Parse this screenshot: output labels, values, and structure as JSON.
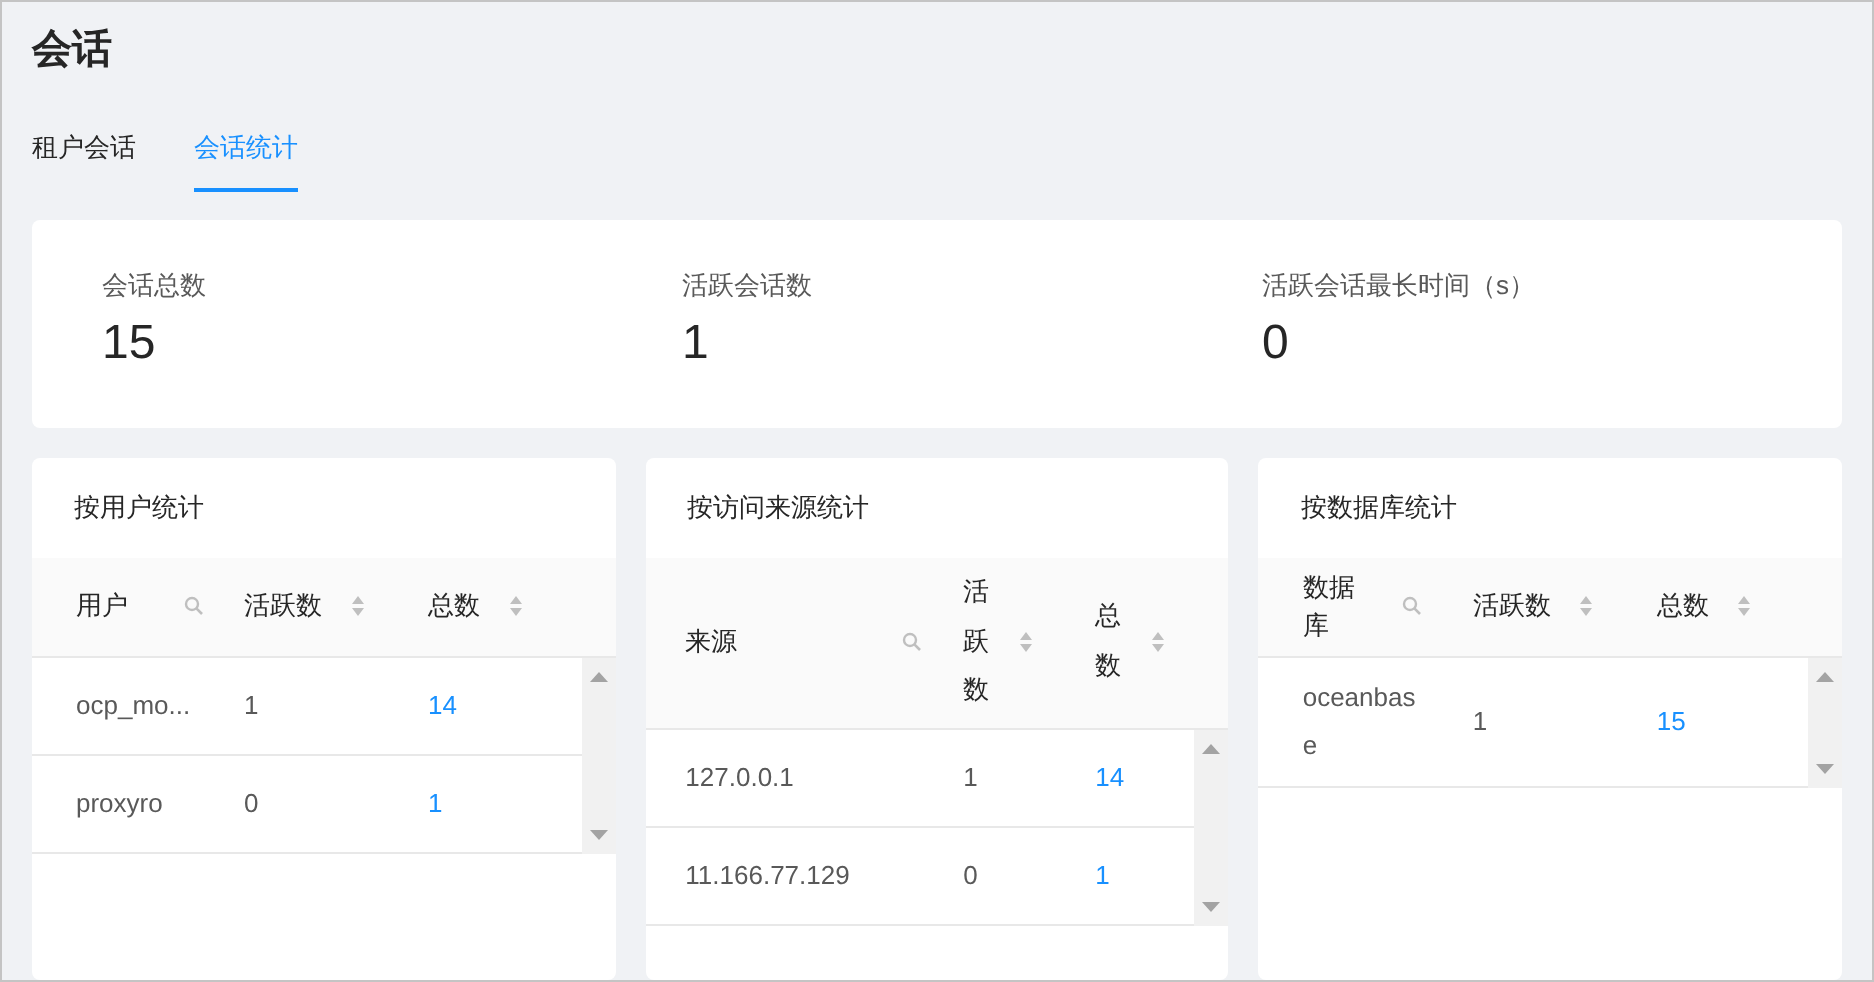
{
  "page_title": "会话",
  "tabs": [
    {
      "label": "租户会话",
      "selected": false
    },
    {
      "label": "会话统计",
      "selected": true
    }
  ],
  "stats": [
    {
      "label": "会话总数",
      "value": "15"
    },
    {
      "label": "活跃会话数",
      "value": "1"
    },
    {
      "label": "活跃会话最长时间（s）",
      "value": "0"
    }
  ],
  "panels": [
    {
      "title": "按用户统计",
      "columns": [
        {
          "label": "用户",
          "kind": "search"
        },
        {
          "label": "活跃数",
          "kind": "sort"
        },
        {
          "label": "总数",
          "kind": "sort"
        }
      ],
      "rows": [
        [
          "ocp_mo...",
          "1",
          "14"
        ],
        [
          "proxyro",
          "0",
          "1"
        ]
      ]
    },
    {
      "title": "按访问来源统计",
      "columns": [
        {
          "label": "来源",
          "kind": "search"
        },
        {
          "label": "活跃数",
          "kind": "sort"
        },
        {
          "label": "总数",
          "kind": "sort"
        }
      ],
      "rows": [
        [
          "127.0.0.1",
          "1",
          "14"
        ],
        [
          "11.166.77.129",
          "0",
          "1"
        ]
      ]
    },
    {
      "title": "按数据库统计",
      "columns": [
        {
          "label": "数据库",
          "kind": "search"
        },
        {
          "label": "活跃数",
          "kind": "sort"
        },
        {
          "label": "总数",
          "kind": "sort"
        }
      ],
      "rows": [
        [
          "oceanbase",
          "1",
          "15"
        ]
      ]
    }
  ]
}
